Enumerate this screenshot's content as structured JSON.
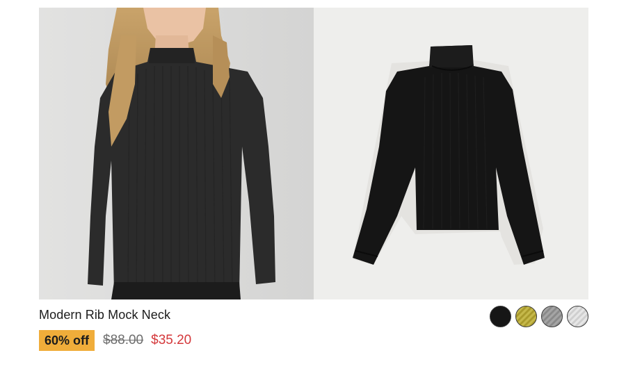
{
  "product": {
    "title": "Modern Rib Mock Neck",
    "discount_badge": "60% off",
    "original_price": "$88.00",
    "sale_price": "$35.20",
    "images": [
      {
        "name": "model-photo",
        "background": "#dcdcdb"
      },
      {
        "name": "flat-lay-photo",
        "background": "#eeeeec"
      }
    ],
    "swatches": [
      {
        "name": "black",
        "color": "#161616"
      },
      {
        "name": "olive-gold",
        "color": "#b9ad3a"
      },
      {
        "name": "grey",
        "color": "#9a9a9a"
      },
      {
        "name": "light-grey",
        "color": "#dcdcdc"
      }
    ]
  },
  "colors": {
    "badge": "#f0ad3a",
    "sale_price": "#d4373a",
    "strikethrough_price": "#6d6d6d"
  }
}
